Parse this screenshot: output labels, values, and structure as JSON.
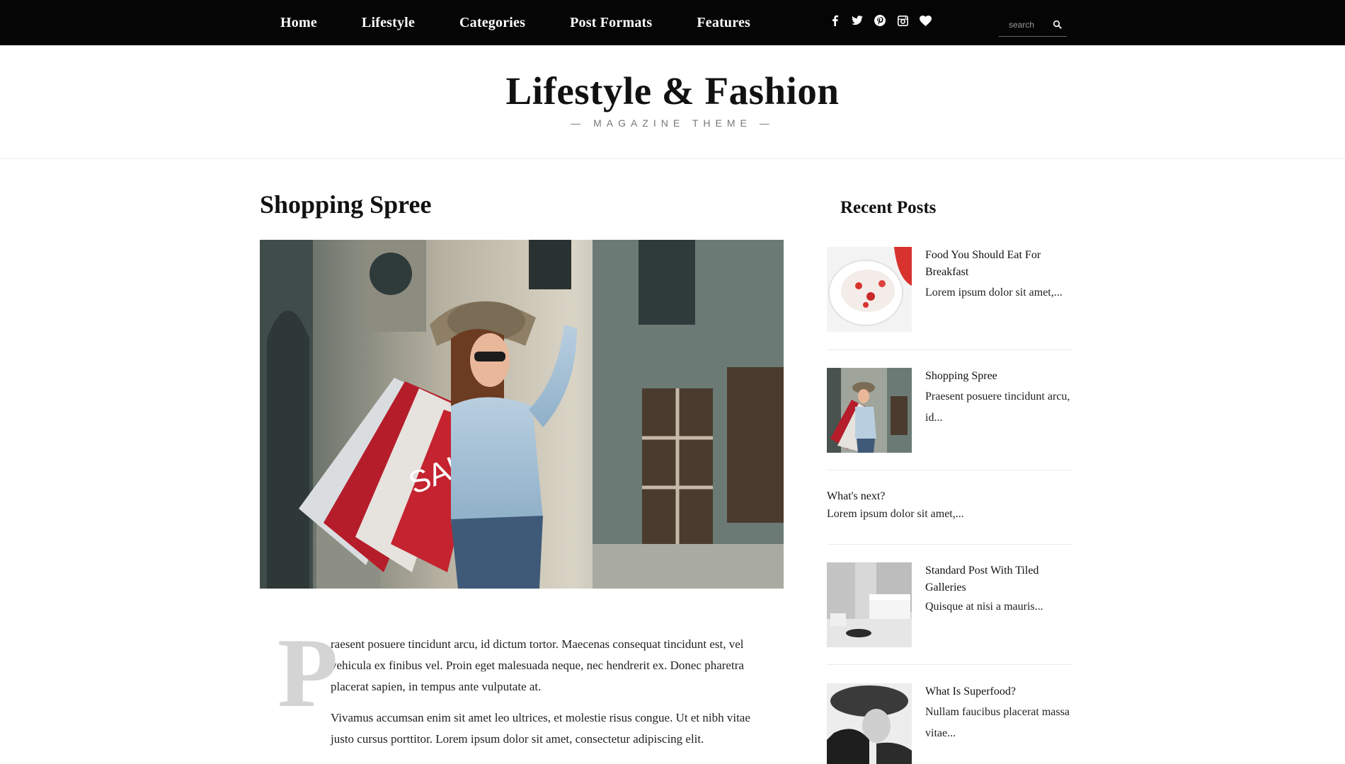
{
  "nav": {
    "items": [
      "Home",
      "Lifestyle",
      "Categories",
      "Post Formats",
      "Features"
    ]
  },
  "social": [
    "facebook-icon",
    "twitter-icon",
    "pinterest-icon",
    "instagram-icon",
    "heart-icon"
  ],
  "search": {
    "placeholder": "search"
  },
  "site": {
    "title": "Lifestyle & Fashion",
    "tagline": "— MAGAZINE THEME —"
  },
  "post": {
    "title": "Shopping Spree",
    "dropcap": "P",
    "paragraphs": [
      "raesent posuere tincidunt arcu, id dictum tortor. Maecenas consequat tincidunt est, vel vehicula ex finibus vel. Proin eget malesuada neque, nec hendrerit ex. Donec pharetra placerat sapien, in tempus ante vulputate at.",
      "Vivamus accumsan enim sit amet leo ultrices, et molestie risus congue. Ut et nibh vitae justo cursus porttitor. Lorem ipsum dolor sit amet, consectetur adipiscing elit."
    ]
  },
  "sidebar": {
    "title": "Recent Posts",
    "posts": [
      {
        "title": "Food You Should Eat For Breakfast",
        "excerpt": "Lorem ipsum dolor sit amet,..."
      },
      {
        "title": "Shopping Spree",
        "excerpt": "Praesent posuere tincidunt arcu, id..."
      },
      {
        "title": "What's next?",
        "excerpt": "Lorem ipsum dolor sit amet,..."
      },
      {
        "title": "Standard Post With Tiled Galleries",
        "excerpt": "Quisque at nisi a mauris..."
      },
      {
        "title": "What Is Superfood?",
        "excerpt": "Nullam faucibus placerat massa vitae..."
      }
    ]
  },
  "colors": {
    "topbar": "#050505",
    "text": "#111111",
    "dropcap": "#d4d4d4",
    "rule": "#ececec"
  }
}
